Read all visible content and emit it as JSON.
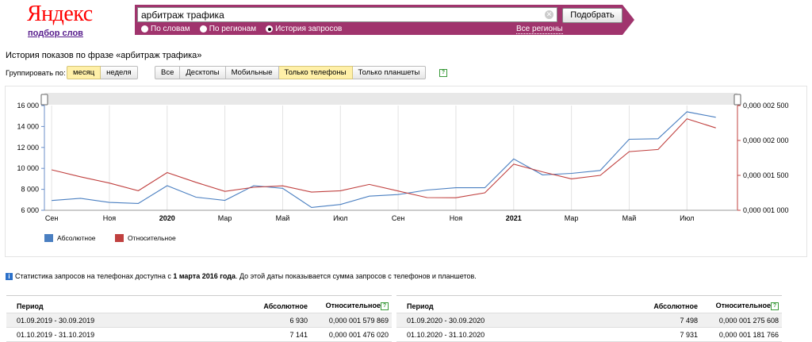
{
  "header": {
    "logo": "Яндекс",
    "sublink": "подбор слов",
    "search_value": "арбитраж трафика",
    "submit_label": "Подобрать",
    "radios": [
      {
        "label": "По словам",
        "selected": false
      },
      {
        "label": "По регионам",
        "selected": false
      },
      {
        "label": "История запросов",
        "selected": true
      }
    ],
    "regions_link": "Все регионы",
    "band_color": "#a0346d"
  },
  "toolbar": {
    "heading": "История показов по фразе «арбитраж трафика»",
    "group_label": "Группировать по:",
    "group": [
      {
        "label": "месяц",
        "selected": true
      },
      {
        "label": "неделя",
        "selected": false
      }
    ],
    "devices": [
      {
        "label": "Все",
        "selected": false
      },
      {
        "label": "Десктопы",
        "selected": false
      },
      {
        "label": "Мобильные",
        "selected": false
      },
      {
        "label": "Только телефоны",
        "selected": true
      },
      {
        "label": "Только планшеты",
        "selected": false
      }
    ],
    "help": "?"
  },
  "chart_data": {
    "type": "line",
    "x": [
      "2019-09",
      "2019-10",
      "2019-11",
      "2019-12",
      "2020-01",
      "2020-02",
      "2020-03",
      "2020-04",
      "2020-05",
      "2020-06",
      "2020-07",
      "2020-08",
      "2020-09",
      "2020-10",
      "2020-11",
      "2020-12",
      "2021-01",
      "2021-02",
      "2021-03",
      "2021-04",
      "2021-05",
      "2021-06",
      "2021-07",
      "2021-08"
    ],
    "x_tick_labels": [
      "Сен",
      "Ноя",
      "2020",
      "Мар",
      "Май",
      "Июл",
      "Сен",
      "Ноя",
      "2021",
      "Мар",
      "Май",
      "Июл"
    ],
    "y_left": {
      "ticks": [
        "6 000",
        "8 000",
        "10 000",
        "12 000",
        "14 000",
        "16 000"
      ],
      "range": [
        6000,
        16000
      ]
    },
    "y_right": {
      "ticks": [
        "0,000 001 000",
        "0,000 001 500",
        "0,000 002 000",
        "0,000 002 500"
      ],
      "range": [
        1e-06,
        2.5e-06
      ]
    },
    "grid": true,
    "legend_position": "bottom-left",
    "series": [
      {
        "name": "Абсолютное",
        "axis": "left",
        "color": "#4a7fc1",
        "values": [
          6930,
          7141,
          6750,
          6650,
          8350,
          7250,
          6950,
          8350,
          8100,
          6270,
          6550,
          7350,
          7498,
          7931,
          8150,
          8150,
          10900,
          9380,
          9520,
          9800,
          12780,
          12830,
          15400,
          14880
        ]
      },
      {
        "name": "Относительное",
        "axis": "right",
        "color": "#c0403f",
        "values": [
          1.58e-06,
          1.48e-06,
          1.39e-06,
          1.28e-06,
          1.54e-06,
          1.4e-06,
          1.27e-06,
          1.33e-06,
          1.35e-06,
          1.26e-06,
          1.28e-06,
          1.37e-06,
          1.276e-06,
          1.182e-06,
          1.18e-06,
          1.25e-06,
          1.66e-06,
          1.55e-06,
          1.45e-06,
          1.5e-06,
          1.84e-06,
          1.87e-06,
          2.31e-06,
          2.18e-06
        ]
      }
    ]
  },
  "note": {
    "prefix": "Статистика запросов на телефонах доступна с ",
    "bold": "1 марта 2016 года",
    "suffix": ". До этой даты показывается сумма запросов с телефонов и планшетов."
  },
  "tables": [
    {
      "headers": [
        "Период",
        "Абсолютное",
        "Относительное"
      ],
      "rows": [
        [
          "01.09.2019 - 30.09.2019",
          "6 930",
          "0,000 001 579 869"
        ],
        [
          "01.10.2019 - 31.10.2019",
          "7 141",
          "0,000 001 476 020"
        ]
      ]
    },
    {
      "headers": [
        "Период",
        "Абсолютное",
        "Относительное"
      ],
      "rows": [
        [
          "01.09.2020 - 30.09.2020",
          "7 498",
          "0,000 001 275 608"
        ],
        [
          "01.10.2020 - 31.10.2020",
          "7 931",
          "0,000 001 181 766"
        ]
      ]
    }
  ]
}
